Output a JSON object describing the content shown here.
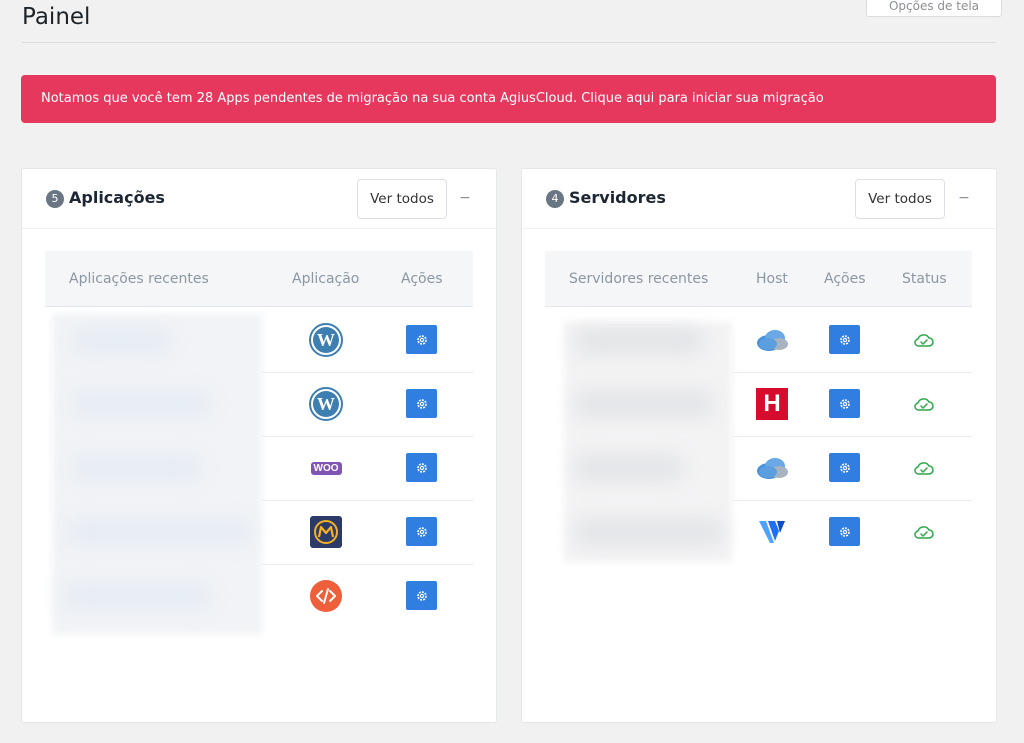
{
  "header": {
    "title": "Painel",
    "screen_options_label": "Opções de tela"
  },
  "notice": {
    "text": "Notamos que você tem 28 Apps pendentes de migração na sua conta AgiusCloud. Clique aqui para iniciar sua migração",
    "color": "#e6375c"
  },
  "applications_panel": {
    "count": "5",
    "title": "Aplicações",
    "view_all_label": "Ver todos",
    "collapse_label": "−",
    "columns": [
      "Aplicações recentes",
      "Aplicação",
      "Ações"
    ],
    "rows": [
      {
        "name": "",
        "app_icon": "wordpress-icon",
        "action_icon": "gear-icon"
      },
      {
        "name": "",
        "app_icon": "wordpress-icon",
        "action_icon": "gear-icon"
      },
      {
        "name": "",
        "app_icon": "woocommerce-icon",
        "action_icon": "gear-icon"
      },
      {
        "name": "",
        "app_icon": "magento-icon",
        "action_icon": "gear-icon"
      },
      {
        "name": "",
        "app_icon": "custom-php-icon",
        "action_icon": "gear-icon"
      }
    ],
    "woo_label": "WOO"
  },
  "servers_panel": {
    "count": "4",
    "title": "Servidores",
    "view_all_label": "Ver todos",
    "collapse_label": "−",
    "columns": [
      "Servidores recentes",
      "Host",
      "Ações",
      "Status"
    ],
    "rows": [
      {
        "name": "",
        "host_icon": "cloud-host-icon",
        "action_icon": "gear-icon",
        "status_icon": "cloud-check-icon"
      },
      {
        "name": "",
        "host_icon": "hetzner-icon",
        "action_icon": "gear-icon",
        "status_icon": "cloud-check-icon"
      },
      {
        "name": "",
        "host_icon": "cloud-host-icon",
        "action_icon": "gear-icon",
        "status_icon": "cloud-check-icon"
      },
      {
        "name": "",
        "host_icon": "vultr-icon",
        "action_icon": "gear-icon",
        "status_icon": "cloud-check-icon"
      }
    ],
    "hetzner_label": "H"
  },
  "colors": {
    "accent_button": "#2f7ee0",
    "status_ok": "#2ea84a",
    "wordpress": "#3d7fb0",
    "woocommerce": "#7f54b3",
    "hetzner": "#d50c2d",
    "vultr": "#1f6ff0",
    "php": "#ef5f3c"
  }
}
